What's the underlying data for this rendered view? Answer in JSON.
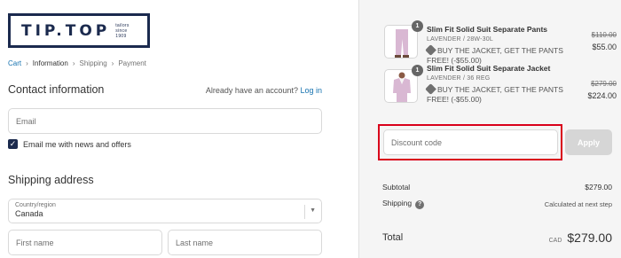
{
  "brand": {
    "logo_text": "TIP.TOP",
    "logo_sub_lines": [
      "tailors",
      "since",
      "1909"
    ]
  },
  "breadcrumb": {
    "items": [
      "Cart",
      "Information",
      "Shipping",
      "Payment"
    ]
  },
  "contact": {
    "title": "Contact information",
    "login_prompt": "Already have an account?",
    "login_link": "Log in",
    "email_placeholder": "Email",
    "newsletter_label": "Email me with news and offers",
    "newsletter_checked": true
  },
  "shipping": {
    "title": "Shipping address",
    "country_label": "Country/region",
    "country_value": "Canada",
    "first_name_placeholder": "First name",
    "last_name_placeholder": "Last name"
  },
  "cart": {
    "items": [
      {
        "quantity": "1",
        "name": "Slim Fit Solid Suit Separate Pants",
        "variant": "LAVENDER / 28W-30L",
        "discount": "BUY THE JACKET, GET THE PANTS FREE! (-$55.00)",
        "price_original": "$110.00",
        "price_final": "$55.00"
      },
      {
        "quantity": "1",
        "name": "Slim Fit Solid Suit Separate Jacket",
        "variant": "LAVENDER / 36 REG",
        "discount": "BUY THE JACKET, GET THE PANTS FREE! (-$55.00)",
        "price_original": "$279.00",
        "price_final": "$224.00"
      }
    ],
    "discount_placeholder": "Discount code",
    "apply_label": "Apply",
    "subtotal_label": "Subtotal",
    "subtotal_value": "$279.00",
    "shipping_label": "Shipping",
    "shipping_value": "Calculated at next step",
    "total_label": "Total",
    "currency": "CAD",
    "total_value": "$279.00"
  },
  "colors": {
    "brand_navy": "#1b2a4e",
    "link_blue": "#1773b0",
    "highlight_red": "#d9001b",
    "product_lavender": "#d9b8d3"
  },
  "icons": {
    "breadcrumb_separator": "chevron-right-icon",
    "checkbox": "check-icon",
    "select": "chevron-down-icon",
    "discount": "tag-icon",
    "shipping_help": "question-icon"
  }
}
